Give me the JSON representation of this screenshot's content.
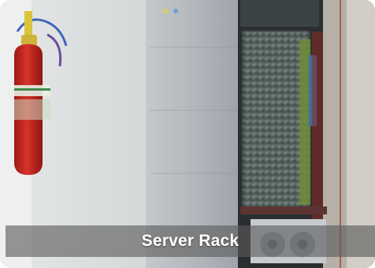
{
  "photo": {
    "subject": "server-rack-with-fire-extinguisher"
  },
  "caption": {
    "label": "Server Rack"
  },
  "colors": {
    "caption_overlay": "#5a5a5a",
    "caption_text": "#ffffff",
    "extinguisher": "#c7251c"
  }
}
